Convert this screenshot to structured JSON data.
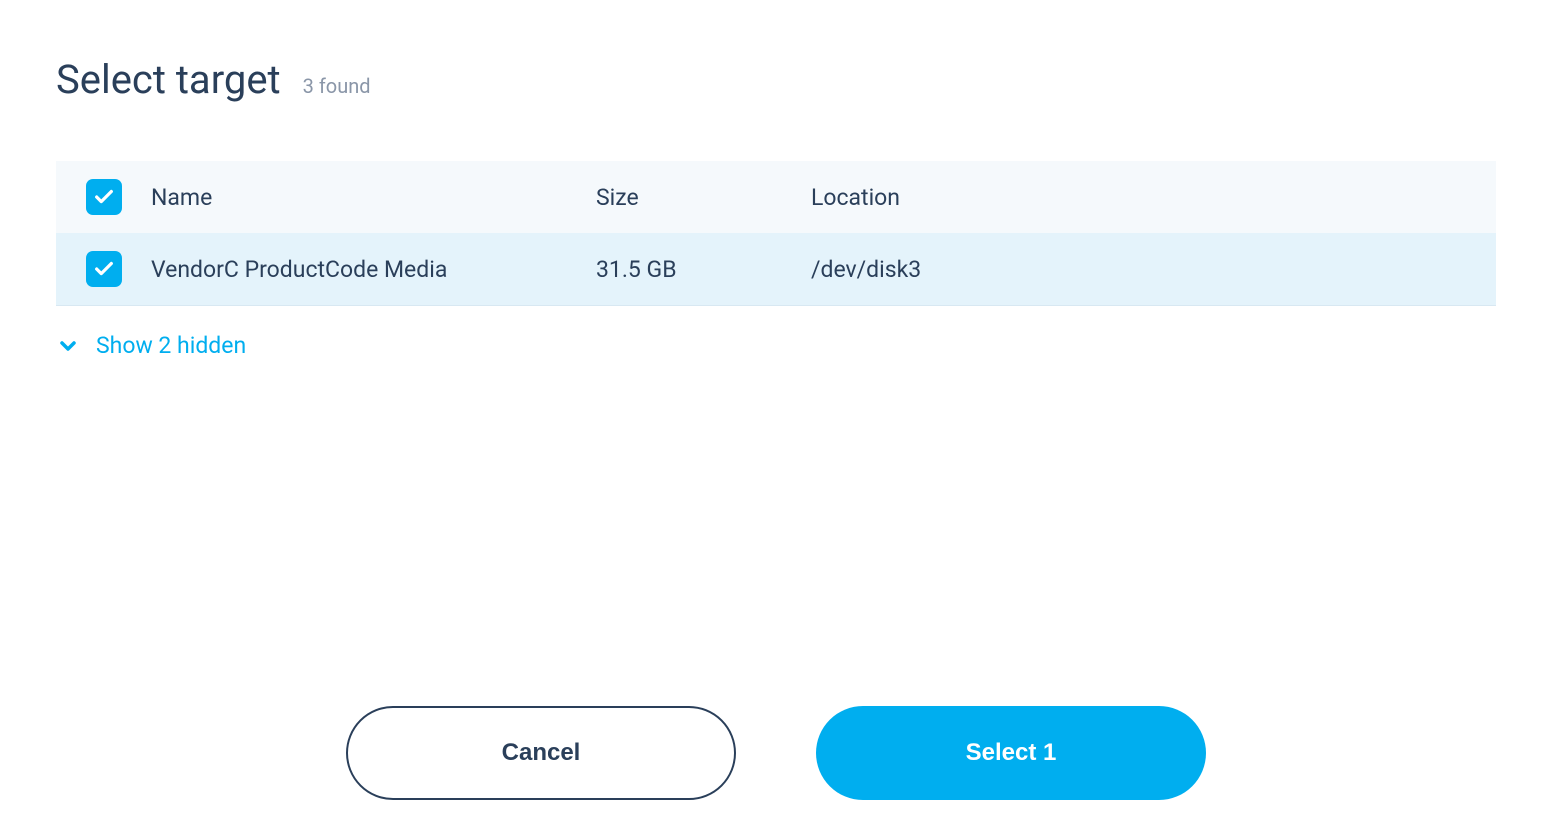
{
  "header": {
    "title": "Select target",
    "found_label": "3 found"
  },
  "table": {
    "columns": {
      "name": "Name",
      "size": "Size",
      "location": "Location"
    },
    "rows": [
      {
        "name": "VendorC ProductCode Media",
        "size": "31.5 GB",
        "location": "/dev/disk3",
        "checked": true
      }
    ]
  },
  "show_hidden": {
    "label": "Show 2 hidden"
  },
  "footer": {
    "cancel_label": "Cancel",
    "select_label": "Select 1"
  }
}
